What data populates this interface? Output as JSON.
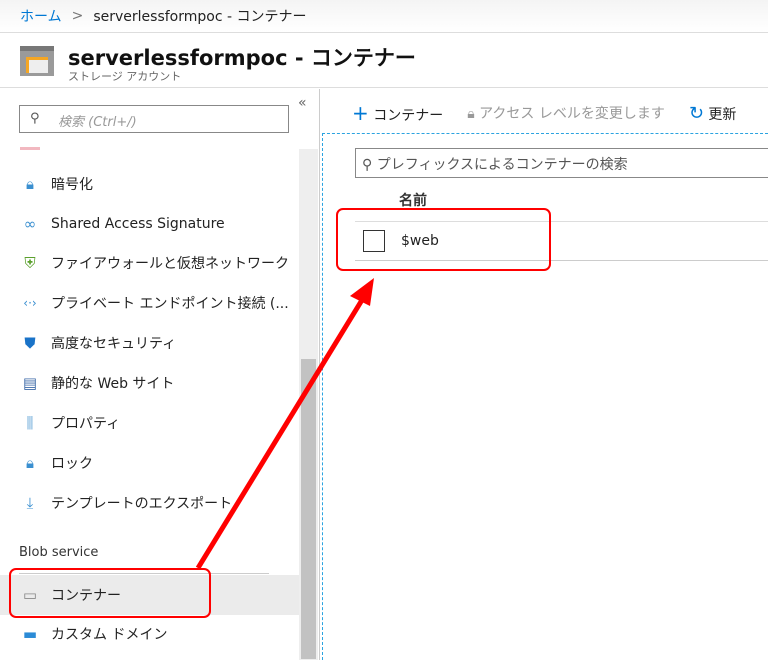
{
  "breadcrumb": {
    "home": "ホーム",
    "sep": ">",
    "current": "serverlessformpoc - コンテナー"
  },
  "header": {
    "title": "serverlessformpoc - コンテナー",
    "subtitle": "ストレージ アカウント"
  },
  "sidebar": {
    "search_placeholder": "検索 (Ctrl+/)",
    "collapse": "«",
    "items": [
      {
        "label": "暗号化",
        "icon": "lock-icon"
      },
      {
        "label": "Shared Access Signature",
        "icon": "link-icon"
      },
      {
        "label": "ファイアウォールと仮想ネットワーク",
        "icon": "firewall-icon"
      },
      {
        "label": "プライベート エンドポイント接続 (...",
        "icon": "endpoint-icon"
      },
      {
        "label": "高度なセキュリティ",
        "icon": "shield-icon"
      },
      {
        "label": "静的な Web サイト",
        "icon": "website-icon"
      },
      {
        "label": "プロパティ",
        "icon": "properties-icon"
      },
      {
        "label": "ロック",
        "icon": "lock-icon"
      },
      {
        "label": "テンプレートのエクスポート",
        "icon": "export-icon"
      }
    ],
    "section": "Blob service",
    "blob_items": [
      {
        "label": "コンテナー",
        "icon": "container-icon",
        "selected": true
      },
      {
        "label": "カスタム ドメイン",
        "icon": "domain-icon"
      }
    ]
  },
  "toolbar": {
    "add": "コンテナー",
    "access": "アクセス レベルを変更します",
    "refresh": "更新"
  },
  "main": {
    "search_placeholder": "プレフィックスによるコンテナーの検索",
    "column": "名前",
    "rows": [
      {
        "name": "$web"
      }
    ]
  }
}
